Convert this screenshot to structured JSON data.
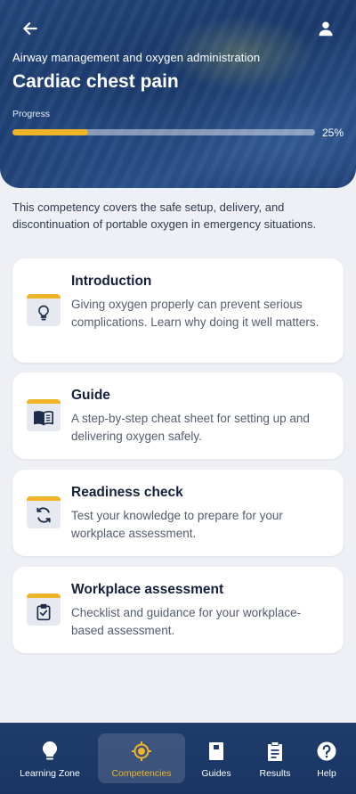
{
  "header": {
    "subtitle": "Airway management and oxygen administration",
    "title": "Cardiac chest pain",
    "progress_label": "Progress",
    "progress_value": "25%",
    "progress_fraction": 0.25
  },
  "description": "This competency covers the safe setup, delivery, and discontinuation of portable oxygen in emergency situations.",
  "cards": [
    {
      "title": "Introduction",
      "desc": "Giving oxygen properly can prevent serious complications. Learn why doing it well matters.",
      "icon": "lightbulb-icon"
    },
    {
      "title": "Guide",
      "desc": "A step-by-step cheat sheet for setting up and delivering oxygen safely.",
      "icon": "book-open-icon"
    },
    {
      "title": "Readiness check",
      "desc": "Test your knowledge to prepare for your workplace assessment.",
      "icon": "refresh-icon"
    },
    {
      "title": "Workplace assessment",
      "desc": "Checklist and guidance for your workplace-based assessment.",
      "icon": "clipboard-check-icon"
    }
  ],
  "nav": [
    {
      "label": "Learning Zone",
      "icon": "lightbulb-icon",
      "active": false
    },
    {
      "label": "Competencies",
      "icon": "target-icon",
      "active": true
    },
    {
      "label": "Guides",
      "icon": "book-icon",
      "active": false
    },
    {
      "label": "Results",
      "icon": "clipboard-icon",
      "active": false
    },
    {
      "label": "Help",
      "icon": "help-icon",
      "active": false
    }
  ],
  "colors": {
    "accent": "#f0b429",
    "navy": "#1f3c6c",
    "card_title": "#14213d"
  }
}
